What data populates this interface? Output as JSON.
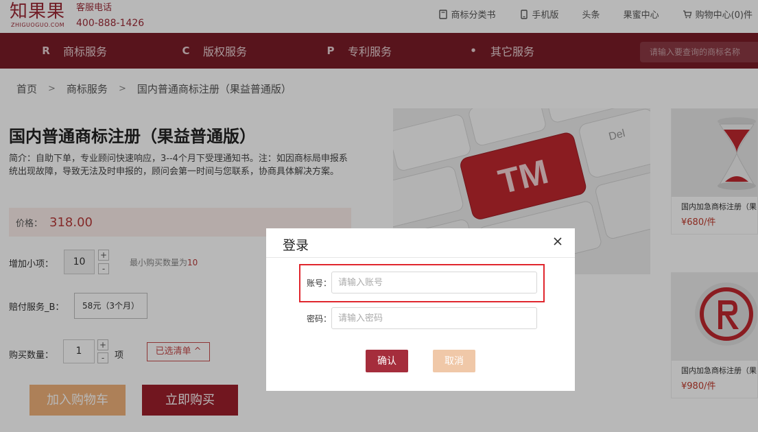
{
  "brand": {
    "logo_text": "知果果",
    "logo_sub": "ZHIGUOGUO.COM",
    "hotline_label": "客服电话",
    "hotline": "400-888-1426"
  },
  "topnav": {
    "items": [
      {
        "label": "商标分类书",
        "icon": "book-icon"
      },
      {
        "label": "手机版",
        "icon": "mobile-icon"
      },
      {
        "label": "头条",
        "icon": ""
      },
      {
        "label": "果蜜中心",
        "icon": ""
      },
      {
        "label": "购物中心(0)件",
        "icon": "cart-icon"
      }
    ]
  },
  "mainnav": {
    "items": [
      {
        "label": "商标服务",
        "icon_glyph": "R"
      },
      {
        "label": "版权服务",
        "icon_glyph": "C"
      },
      {
        "label": "专利服务",
        "icon_glyph": "P"
      },
      {
        "label": "其它服务",
        "icon_glyph": "•"
      }
    ],
    "search_placeholder": "请输入要查询的商标名称"
  },
  "breadcrumb": {
    "items": [
      "首页",
      "商标服务",
      "国内普通商标注册（果益普通版）"
    ],
    "separator": ">"
  },
  "product": {
    "title": "国内普通商标注册（果益普通版）",
    "intro": "简介：自助下单，专业顾问快速响应，3--4个月下受理通知书。注：如因商标局申报系统出现故障，导致无法及时申报的，顾问会第一时间与您联系，协商具体解决方案。",
    "price_label": "价格：",
    "price": "318.00",
    "addon_label": "增加小项：",
    "addon_qty": "10",
    "addon_hint": "最小购买数量为",
    "addon_min": "10",
    "service_label": "赔付服务_B：",
    "service_option": "58元（3个月）",
    "qty_label": "购买数量：",
    "qty": "1",
    "qty_unit": "项",
    "selected_label": "已选清单 ^",
    "add_cart": "加入购物车",
    "buy_now": "立即购买",
    "image_key_text": "TM",
    "image_del_text": "Del"
  },
  "recommend": [
    {
      "name": "国内加急商标注册（果",
      "price": "¥680/件"
    },
    {
      "name": "国内加急商标注册（果",
      "price": "¥980/件"
    }
  ],
  "modal": {
    "title": "登录",
    "account_label": "账号：",
    "account_placeholder": "请输入账号",
    "password_label": "密码：",
    "password_placeholder": "请输入密码",
    "confirm": "确认",
    "cancel": "取消"
  },
  "colors": {
    "brand": "#9d2a36",
    "nav_bg": "#7a1d28",
    "price": "#b83a3a",
    "highlight": "#e0252c",
    "confirm_bg": "#a52d3c",
    "cancel_bg": "#f0c8a8"
  }
}
